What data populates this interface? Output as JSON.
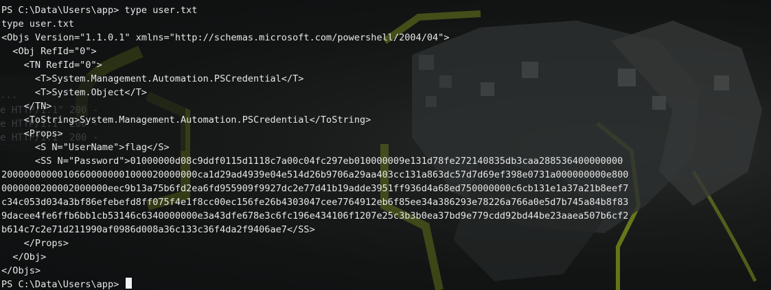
{
  "terminal": {
    "lines": [
      "PS C:\\Data\\Users\\app> type user.txt",
      "type user.txt",
      "<Objs Version=\"1.1.0.1\" xmlns=\"http://schemas.microsoft.com/powershell/2004/04\">",
      "  <Obj RefId=\"0\">",
      "    <TN RefId=\"0\">",
      "      <T>System.Management.Automation.PSCredential</T>",
      "      <T>System.Object</T>",
      "    </TN>",
      "    <ToString>System.Management.Automation.PSCredential</ToString>",
      "    <Props>",
      "      <S N=\"UserName\">flag</S>",
      "      <SS N=\"Password\">01000000d08c9ddf0115d1118c7a00c04fc297eb010000009e131d78fe272140835db3caa288536400000000",
      "20000000000106600000001000020000000ca1d29ad4939e04e514d26b9706a29aa403cc131a863dc57d7d69ef398e0731a000000000e800",
      "0000000200002000000eec9b13a75b6fd2ea6fd955909f9927dc2e77d41b19adde3951ff936d4a68ed750000000c6cb131e1a37a21b8eef7",
      "c34c053d034a3bf86efebefd8ff075f4e1f8cc00ec156fe26b4303047cee7764912eb6f85ee34a386293e78226a766a0e5d7b745a84b8f83",
      "9dacee4fe6ffb6bb1cb53146c6340000000e3a43dfe678e3c6fc196e434106f1207e25c3b3b0ea37bd9e779cdd92bd44be23aaea507b6cf2",
      "b614c7c2e71d211990af0986d008a36c133c36f4da2f9406ae7</SS>",
      "    </Props>",
      "  </Obj>",
      "</Objs>"
    ],
    "prompt": "PS C:\\Data\\Users\\app> ",
    "ghost_lines": [
      "...",
      "e HTTP/1.1\" 200 -",
      "e HTTP/1.1\" 200 -",
      "e HTTP/1.1\" 200 -"
    ]
  },
  "colors": {
    "text": "#e6e6e6",
    "accent": "#b5d21f"
  }
}
